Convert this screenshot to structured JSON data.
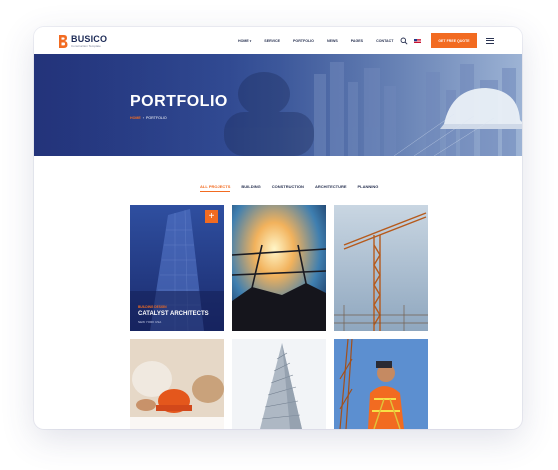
{
  "header": {
    "logo_name": "BUSICO",
    "logo_tagline": "Construction Template",
    "nav": [
      {
        "label": "HOME",
        "caret": "▾"
      },
      {
        "label": "SERVICE"
      },
      {
        "label": "PORTFOLIO"
      },
      {
        "label": "NEWS"
      },
      {
        "label": "PAGES"
      },
      {
        "label": "CONTACT"
      }
    ],
    "cta_label": "GET FREE QUOTE"
  },
  "hero": {
    "title": "PORTFOLIO",
    "breadcrumb_home": "HOME",
    "breadcrumb_sep": "›",
    "breadcrumb_current": "PORTFOLIO"
  },
  "tabs": [
    {
      "label": "ALL PROJECTS",
      "active": true
    },
    {
      "label": "BUILDING"
    },
    {
      "label": "CONSTRUCTION"
    },
    {
      "label": "ARCHITECTURE"
    },
    {
      "label": "PLANNING"
    }
  ],
  "featured_project": {
    "category": "BUILDING DESIGN",
    "title": "CATALYST ARCHITECTS",
    "subtitle": "NEW YORK USA",
    "plus_label": "+"
  },
  "colors": {
    "accent": "#f26b21",
    "navy": "#1c2a56",
    "hero_blue": "#2c4590"
  },
  "icons": [
    "search-icon",
    "flag-icon",
    "menu-icon",
    "plus-icon"
  ]
}
